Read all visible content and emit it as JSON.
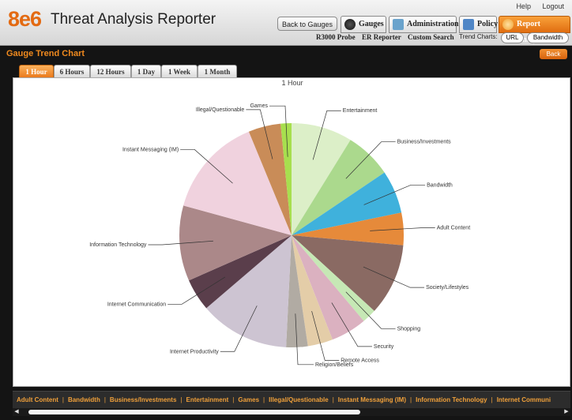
{
  "app": {
    "logo": "8e6",
    "title": "Threat Analysis Reporter"
  },
  "header": {
    "help": "Help",
    "logout": "Logout",
    "back_to_gauges": "Back to Gauges",
    "tabs": [
      {
        "label": "Gauges",
        "icon": "gauge-icon"
      },
      {
        "label": "Administration",
        "icon": "admin-icon"
      },
      {
        "label": "Policy",
        "icon": "policy-icon"
      },
      {
        "label": "Report Analysis",
        "icon": "report-icon"
      }
    ],
    "sublinks": [
      "R3000 Probe",
      "ER Reporter",
      "Custom Search"
    ],
    "trend_charts_label": "Trend Charts:",
    "trend_buttons": [
      "URL",
      "Bandwidth"
    ]
  },
  "page": {
    "title": "Gauge Trend Chart",
    "back": "Back"
  },
  "time_tabs": [
    "1 Hour",
    "6 Hours",
    "12 Hours",
    "1 Day",
    "1 Week",
    "1 Month"
  ],
  "colors": {
    "accent": "#f08a1e",
    "header_bg": "#e4e4e4",
    "page_bg": "#141414"
  },
  "chart_data": {
    "type": "pie",
    "title": "1 Hour",
    "slices": [
      {
        "label": "Entertainment",
        "value": 8.5,
        "color": "#dcefc8"
      },
      {
        "label": "Business/Investments",
        "value": 6.5,
        "color": "#abd98d"
      },
      {
        "label": "Bandwidth",
        "value": 6.0,
        "color": "#3fb1dc"
      },
      {
        "label": "Adult Content",
        "value": 4.5,
        "color": "#e68a3a"
      },
      {
        "label": "Society/Lifestyles",
        "value": 10.0,
        "color": "#8a6a63"
      },
      {
        "label": "Shopping",
        "value": 2.0,
        "color": "#c6e8b5"
      },
      {
        "label": "Security",
        "value": 5.0,
        "color": "#dbb1c0"
      },
      {
        "label": "Remote Access",
        "value": 3.5,
        "color": "#e4cda8"
      },
      {
        "label": "Religion/Beliefs",
        "value": 3.0,
        "color": "#b1aba3"
      },
      {
        "label": "Internet Productivity",
        "value": 12.5,
        "color": "#cdc4d2"
      },
      {
        "label": "Internet Communication",
        "value": 4.5,
        "color": "#5a3e4b"
      },
      {
        "label": "Information Technology",
        "value": 10.5,
        "color": "#ab8889"
      },
      {
        "label": "Instant Messaging (IM)",
        "value": 14.0,
        "color": "#f0d2de"
      },
      {
        "label": "Illegal/Questionable",
        "value": 4.5,
        "color": "#c98c58"
      },
      {
        "label": "Games",
        "value": 1.5,
        "color": "#a7df4e"
      }
    ]
  },
  "legend_items": [
    "Adult Content",
    "Bandwidth",
    "Business/Investments",
    "Entertainment",
    "Games",
    "Illegal/Questionable",
    "Instant Messaging (IM)",
    "Information Technology",
    "Internet Communi"
  ]
}
